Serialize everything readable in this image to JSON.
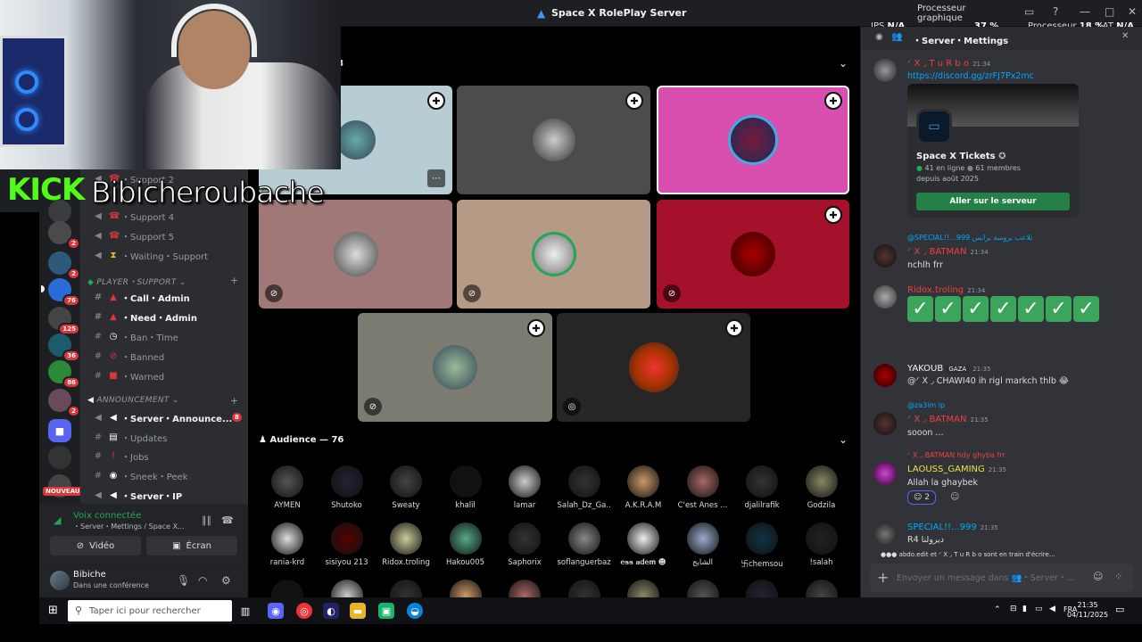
{
  "window": {
    "title": "Space X RolePlay Server",
    "perf": {
      "ips_label": "IPS",
      "ips_value": "N/A",
      "gpu_label": "Processeur graphique",
      "gpu_value": "37 %",
      "cpu_label": "Processeur",
      "cpu_value": "18 %",
      "lat_label": "LAT",
      "lat_value": "N/A"
    }
  },
  "overlay": {
    "brand": "KICK",
    "streamer": "Bibicheroubache"
  },
  "rail": {
    "badges": [
      "2",
      "2",
      "76",
      "125",
      "36",
      "86",
      "2"
    ],
    "new_label": "NOUVEAU"
  },
  "sidebar": {
    "channels_top": [
      {
        "icon": "speaker-icon",
        "name": "・Support 2"
      },
      {
        "icon": "speaker-icon",
        "name": "・Support 4"
      },
      {
        "icon": "speaker-icon",
        "name": "・Support 5"
      },
      {
        "icon": "speaker-icon",
        "name": "・Waiting・Support"
      }
    ],
    "cat_support": "PLAYER・SUPPORT",
    "support_channels": [
      {
        "name": "・Call・Admin",
        "bold": true
      },
      {
        "name": "・Need・Admin",
        "bold": true
      },
      {
        "name": "・Ban・Time",
        "bold": false
      },
      {
        "name": "・Banned",
        "bold": false
      },
      {
        "name": "・Warned",
        "bold": false
      }
    ],
    "cat_announce": "ANNOUNCEMENT",
    "announce_channels": [
      {
        "name": "・Server・Announce...",
        "bold": true,
        "badge": "8"
      },
      {
        "name": "・Updates",
        "bold": false
      },
      {
        "name": "・Jobs",
        "bold": false
      },
      {
        "name": "・Sneek・Peek",
        "bold": false
      },
      {
        "name": "・Server・IP",
        "bold": true
      }
    ]
  },
  "voice": {
    "status": "Voix connectée",
    "path": "・Server・Mettings / Space X...",
    "video_label": "Vidéo",
    "screen_label": "Écran"
  },
  "user": {
    "name": "Bibiche",
    "status": "Dans une conférence"
  },
  "stage": {
    "speakers_count_suffix": "8",
    "audience_label": "Audience — 76",
    "tiles": [
      {
        "bg": "#b7cdd3",
        "speaking": false
      },
      {
        "bg": "#4a4d4a",
        "speaking": false
      },
      {
        "bg": "#d94fb0",
        "speaking": true
      },
      {
        "bg": "#a07878",
        "speaking": false
      },
      {
        "bg": "#b59a86",
        "speaking": false
      },
      {
        "bg": "#a5102a",
        "speaking": false
      },
      {
        "bg": "#7b7b72",
        "speaking": false
      },
      {
        "bg": "#262626",
        "speaking": false
      }
    ],
    "audience_row1": [
      "AYMEN",
      "Shutoko",
      "Sweaty",
      "khalil",
      "lamar",
      "Salah_Dz_Ga...",
      "A.K.R.A.M",
      "C'est Anes ...",
      "djalilrafik",
      "Godzila"
    ],
    "audience_row2": [
      "rania-krd",
      "sisiyou 213",
      "Ridox.troling",
      "Hakou005",
      "Saphorix",
      "soflanguerbazi_",
      "𝐞𝐬𝐬 𝐚𝐝𝐞𝐦 ☻",
      "الشايج",
      "卐chemsou",
      "!salah"
    ]
  },
  "chat": {
    "channel": "・Server・Mettings",
    "m1": {
      "author": "ᐟ X ◞ T u R b o",
      "time": "21:34",
      "link": "https://discord.gg/zrFJ7Px2mc"
    },
    "invite": {
      "name": "Space X Tickets",
      "online": "41 en ligne",
      "members": "61 membres",
      "since": "depuis août 2025",
      "button": "Aller sur le serveur"
    },
    "m2": {
      "reply": "@SPECIAL!!...999 تلاعب بروسة برابس",
      "author": "ᐟ X ◞ BATMAN",
      "time": "21:34",
      "text": "nchlh frr"
    },
    "m3": {
      "author": "Ridox.troling",
      "time": "21:34",
      "checks": 7
    },
    "m4": {
      "author": "YAKOUB",
      "tag": "GAZA",
      "time": "21:35",
      "text": "@ᐟ X ◞ CHAWI40 ih rigl markch thlb 😂"
    },
    "m5": {
      "reply": "@za3im ip",
      "author": "ᐟ X ◞ BATMAN",
      "time": "21:35",
      "text": "sooon ..."
    },
    "m6": {
      "reply": "ᐟ X ◞ BATMAN hdy ghyba frr",
      "author": "LAOUSS_GAMING",
      "time": "21:35",
      "text": "Allah la ghaybek",
      "reaction": "2"
    },
    "m7": {
      "author": "SPECIAL!!...999",
      "time": "21:35",
      "text": "R4 ديرولنا"
    },
    "typing": "abdo.edit et ᐟ X ◞ T u R b o sont en train d'écrire...",
    "input_placeholder": "Envoyer un message dans 👥・Server・..."
  },
  "taskbar": {
    "search_placeholder": "Taper ici pour rechercher",
    "lang": "FRA",
    "time": "21:35",
    "date": "04/11/2025"
  }
}
